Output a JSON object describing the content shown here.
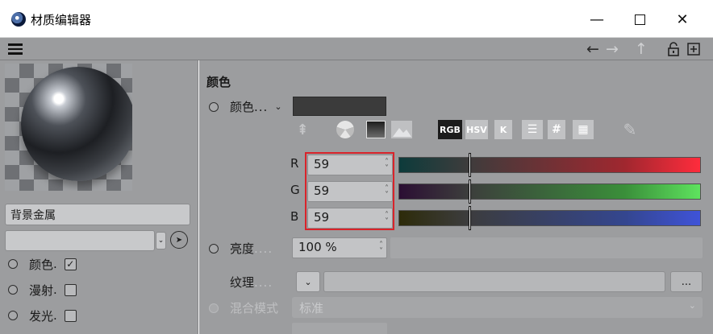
{
  "window": {
    "title": "材质编辑器",
    "controls": {
      "minimize": "—",
      "close": "✕"
    }
  },
  "nav": {
    "back_icon": "←",
    "forward_icon": "→",
    "up_icon": "↑",
    "lock_icon": "🔓",
    "new_icon": "+"
  },
  "left": {
    "material_name": "背景金属",
    "channels": [
      {
        "label": "颜色",
        "dots": ".",
        "checked": true
      },
      {
        "label": "漫射",
        "dots": ".",
        "checked": false
      },
      {
        "label": "发光",
        "dots": ".",
        "checked": false
      }
    ]
  },
  "color_section": {
    "title": "颜色",
    "color_label": "颜色",
    "color_dots": "...",
    "swatch_color": "#3b3b3b",
    "modes": {
      "rgb": "RGB",
      "hsv": "HSV",
      "k": "K",
      "hash": "#"
    },
    "channels": {
      "r": {
        "label": "R",
        "value": "59",
        "fraction": 0.23
      },
      "g": {
        "label": "G",
        "value": "59",
        "fraction": 0.23
      },
      "b": {
        "label": "B",
        "value": "59",
        "fraction": 0.23
      }
    },
    "brightness": {
      "label": "亮度",
      "dots": "....",
      "value": "100 %"
    },
    "texture": {
      "label": "纹理",
      "dots": "....",
      "more": "..."
    },
    "blend_mode": {
      "label": "混合模式",
      "value": "标准"
    }
  },
  "colors": {
    "panel_bg": "#9c9d9f",
    "highlight": "#d9232a"
  }
}
